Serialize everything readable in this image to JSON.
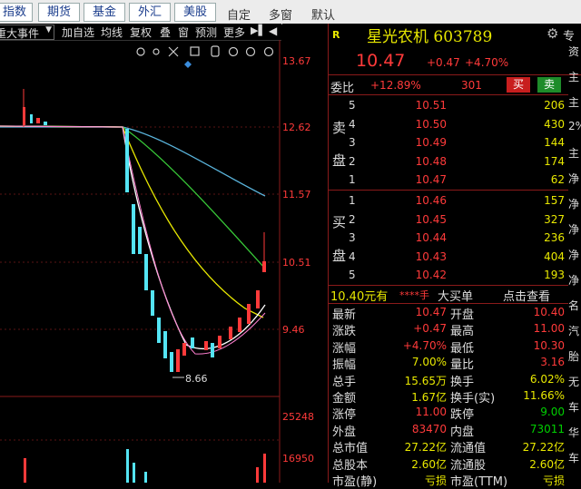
{
  "top_tabs": [
    "指数",
    "期货",
    "基金",
    "外汇",
    "美股"
  ],
  "top_actions": [
    "自定",
    "多窗",
    "默认"
  ],
  "toolbar": {
    "events": "重大事件",
    "items": [
      "加自选",
      "均线",
      "复权",
      "叠",
      "窗",
      "预测",
      "更多"
    ]
  },
  "chart": {
    "price_labels": [
      "13.67",
      "12.62",
      "11.57",
      "10.51",
      "9.46"
    ],
    "volume_labels": [
      "25248",
      "16950"
    ],
    "low_marker": "8.66"
  },
  "quote": {
    "market_badge": "R",
    "name_code": "星光农机 603789",
    "price": "10.47",
    "change": "+0.47",
    "change_pct": "+4.70%",
    "right_label": "专",
    "weibi_label": "委比",
    "weibi_value": "+12.89%",
    "weicha_value": "301",
    "buy_btn": "买",
    "sell_btn": "卖"
  },
  "asks": [
    {
      "level": "5",
      "price": "10.51",
      "vol": "206"
    },
    {
      "level": "4",
      "price": "10.50",
      "vol": "430"
    },
    {
      "level": "3",
      "price": "10.49",
      "vol": "144"
    },
    {
      "level": "2",
      "price": "10.48",
      "vol": "174"
    },
    {
      "level": "1",
      "price": "10.47",
      "vol": "62"
    }
  ],
  "bids": [
    {
      "level": "1",
      "price": "10.46",
      "vol": "157"
    },
    {
      "level": "2",
      "price": "10.45",
      "vol": "327"
    },
    {
      "level": "3",
      "price": "10.44",
      "vol": "236"
    },
    {
      "level": "4",
      "price": "10.43",
      "vol": "404"
    },
    {
      "level": "5",
      "price": "10.42",
      "vol": "193"
    }
  ],
  "ask_side_label": [
    "卖",
    "盘"
  ],
  "bid_side_label": [
    "买",
    "盘"
  ],
  "big_order": {
    "price": "10.40元有",
    "stars": "****手",
    "label": "大买单",
    "link": "点击查看"
  },
  "stats": [
    {
      "l1": "最新",
      "v1": "10.47",
      "c1": "red",
      "l2": "开盘",
      "v2": "10.40",
      "c2": "red"
    },
    {
      "l1": "涨跌",
      "v1": "+0.47",
      "c1": "red",
      "l2": "最高",
      "v2": "11.00",
      "c2": "red"
    },
    {
      "l1": "涨幅",
      "v1": "+4.70%",
      "c1": "red",
      "l2": "最低",
      "v2": "10.30",
      "c2": "red"
    },
    {
      "l1": "振幅",
      "v1": "7.00%",
      "c1": "yel",
      "l2": "量比",
      "v2": "3.16",
      "c2": "red"
    },
    {
      "l1": "总手",
      "v1": "15.65万",
      "c1": "yel",
      "l2": "换手",
      "v2": "6.02%",
      "c2": "yel"
    },
    {
      "l1": "金额",
      "v1": "1.67亿",
      "c1": "yel",
      "l2": "换手(实)",
      "v2": "11.66%",
      "c2": "yel"
    },
    {
      "l1": "涨停",
      "v1": "11.00",
      "c1": "red",
      "l2": "跌停",
      "v2": "9.00",
      "c2": "grn"
    },
    {
      "l1": "外盘",
      "v1": "83470",
      "c1": "red",
      "l2": "内盘",
      "v2": "73011",
      "c2": "grn"
    },
    {
      "l1": "总市值",
      "v1": "27.22亿",
      "c1": "yel",
      "l2": "流通值",
      "v2": "27.22亿",
      "c2": "yel"
    },
    {
      "l1": "总股本",
      "v1": "2.60亿",
      "c1": "yel",
      "l2": "流通股",
      "v2": "2.60亿",
      "c2": "yel"
    },
    {
      "l1": "市盈(静)",
      "v1": "亏损",
      "c1": "yel",
      "l2": "市盈(TTM)",
      "v2": "亏损",
      "c2": "yel"
    }
  ],
  "far_right": [
    "资",
    "主",
    "主",
    "2%",
    "主",
    "净",
    "净",
    "净",
    "净",
    "净",
    "名",
    "汽",
    "胎",
    "无",
    "车",
    "华",
    "车"
  ],
  "colors": {
    "up": "#ff3a3a",
    "down": "#00d000",
    "ma_white": "#ffffff",
    "ma_yellow": "#e8e800",
    "ma_green": "#38c838",
    "ma_blue": "#5ab4dc",
    "candle_down": "#54e4f4"
  }
}
